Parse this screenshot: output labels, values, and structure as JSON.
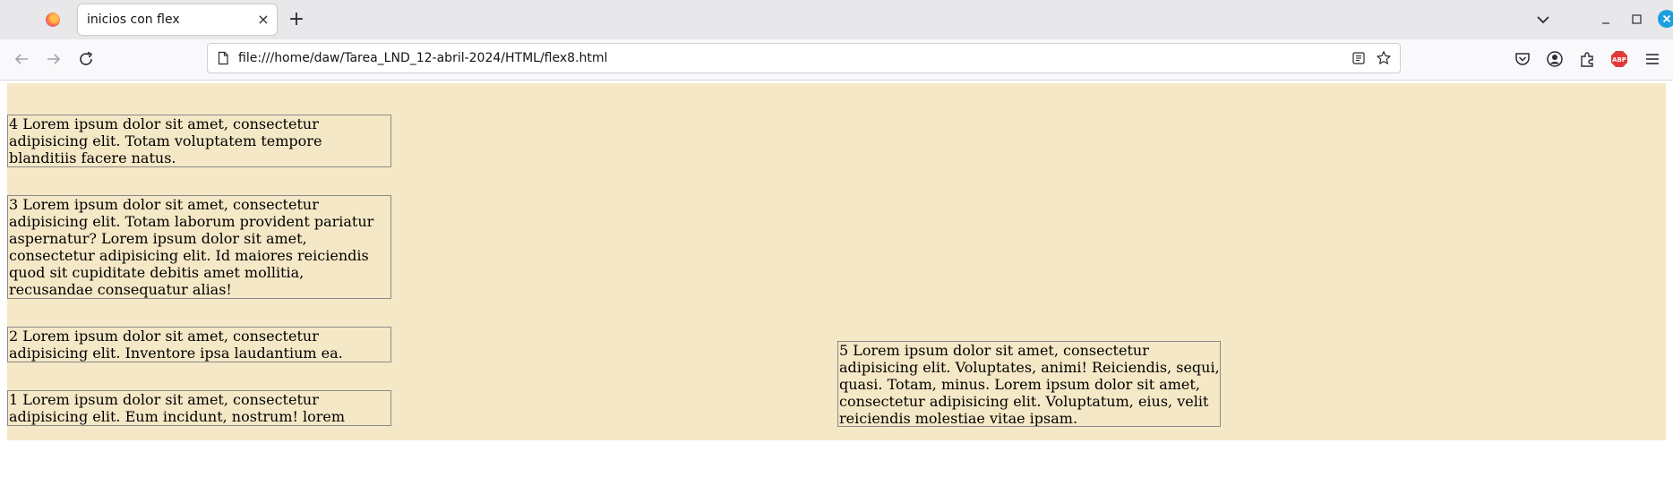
{
  "browser": {
    "tab": {
      "title": "inicios con flex",
      "close_glyph": "×"
    },
    "new_tab_glyph": "+",
    "icons": {
      "app": "firefox-logo",
      "tab_list": "chevron-down-icon",
      "minimize": "minimize-icon",
      "maximize": "maximize-icon",
      "close": "close-window-icon"
    },
    "accent_color": "#1c9fe0"
  },
  "navbar": {
    "url": "file:///home/daw/Tarea_LND_12-abril-2024/HTML/flex8.html",
    "icons": [
      "back-arrow-icon",
      "forward-arrow-icon",
      "reload-icon",
      "page-icon",
      "reader-view-icon",
      "bookmark-star-icon",
      "pocket-icon",
      "account-icon",
      "extensions-icon",
      "adblock-plus-icon",
      "hamburger-menu-icon"
    ],
    "abp_label": "ABP"
  },
  "page": {
    "container_color": "#f5e8c6",
    "items": {
      "item4": "4 Lorem ipsum dolor sit amet, consectetur adipisicing elit. Totam voluptatem tempore blanditiis facere natus.",
      "item3": "3 Lorem ipsum dolor sit amet, consectetur adipisicing elit. Totam laborum provident pariatur aspernatur? Lorem ipsum dolor sit amet, consectetur adipisicing elit. Id maiores reiciendis quod sit cupiditate debitis amet mollitia, recusandae consequatur alias!",
      "item2": "2 Lorem ipsum dolor sit amet, consectetur adipisicing elit. Inventore ipsa laudantium ea.",
      "item1": "1 Lorem ipsum dolor sit amet, consectetur adipisicing elit. Eum incidunt, nostrum! lorem",
      "item5": "5 Lorem ipsum dolor sit amet, consectetur adipisicing elit. Voluptates, animi! Reiciendis, sequi, quasi. Totam, minus. Lorem ipsum dolor sit amet, consectetur adipisicing elit. Voluptatum, eius, velit reiciendis molestiae vitae ipsam."
    }
  }
}
